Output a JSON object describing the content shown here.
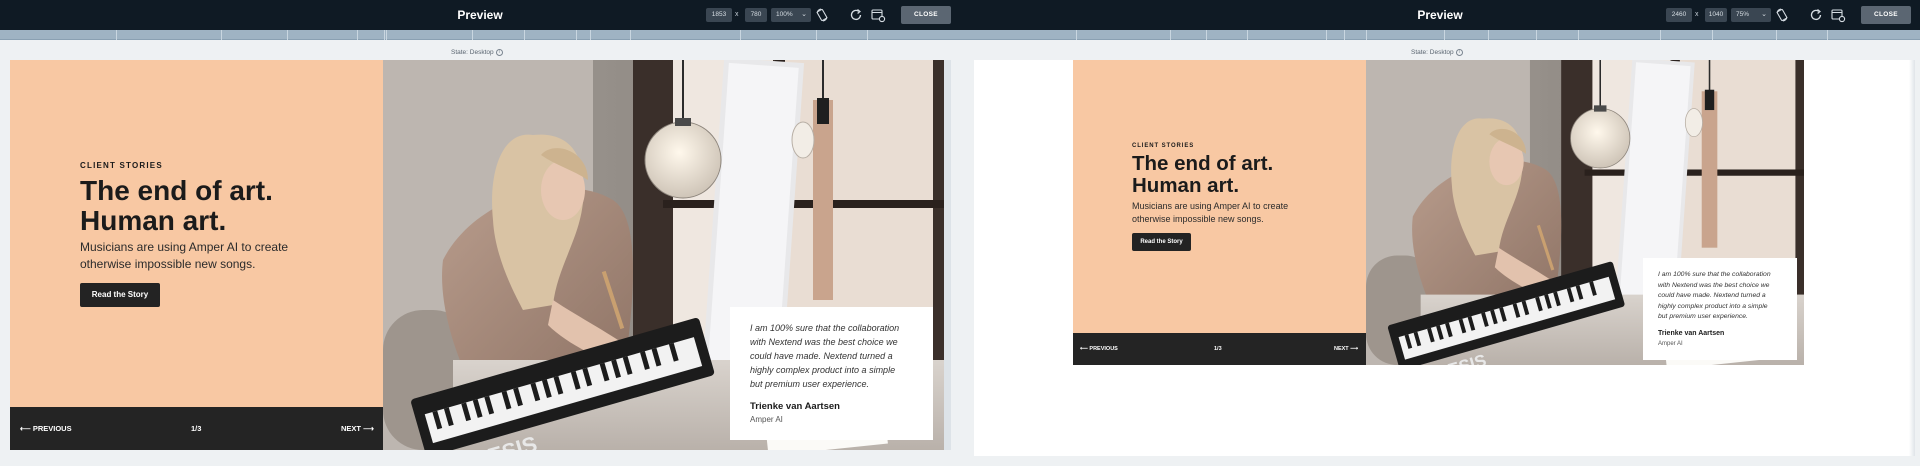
{
  "toolbar": {
    "title": "Preview",
    "close_label": "CLOSE",
    "separator": "x",
    "icons": [
      "rotate-icon",
      "refresh-icon",
      "settings-gear-icon"
    ]
  },
  "panels": [
    {
      "width": "1853",
      "height": "780",
      "zoom": "100%",
      "state_label": "State: Desktop"
    },
    {
      "width": "2460",
      "height": "1040",
      "zoom": "75%",
      "state_label": "State: Desktop"
    }
  ],
  "slide": {
    "eyebrow": "CLIENT STORIES",
    "headline_line1": "The end of art.",
    "headline_line2": "Human art.",
    "description_line1": "Musicians are using Amper AI to create",
    "description_line2": "otherwise impossible new songs.",
    "cta_label": "Read the Story",
    "prev_label": "⟵ PREVIOUS",
    "next_label": "NEXT ⟶",
    "counter": "1/3",
    "quote_lines": [
      "I am 100% sure that the collaboration",
      "with Nextend was the best choice we",
      "could have made. Nextend turned a",
      "highly complex product into a simple",
      "but premium user experience."
    ],
    "quote_author": "Trienke van Aartsen",
    "quote_company": "Amper AI",
    "keyboard_brand": "ALESIS"
  },
  "colors": {
    "topbar": "#0f1a24",
    "peach": "#f8c8a3",
    "dark": "#242424"
  }
}
